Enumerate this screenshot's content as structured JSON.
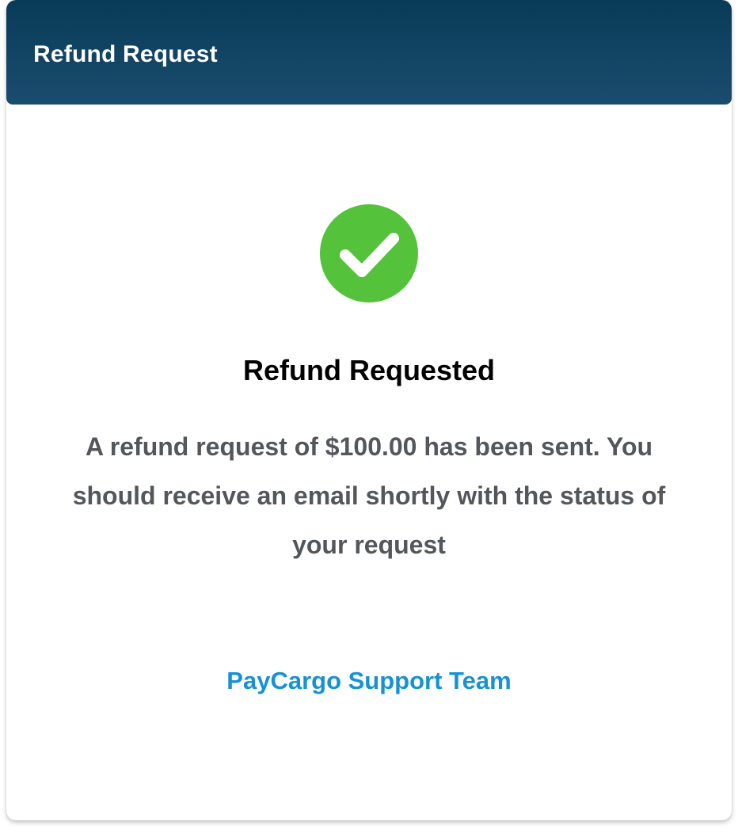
{
  "header": {
    "title": "Refund Request"
  },
  "status": {
    "icon": "check-circle-icon",
    "icon_color": "#54c23a",
    "title": "Refund Requested",
    "message": "A refund request of $100.00 has been sent. You should receive an email shortly with the status of your request"
  },
  "footer": {
    "signature": "PayCargo Support Team",
    "signature_color": "#1592d6"
  },
  "colors": {
    "header_top": "#083b58",
    "header_bottom": "#1b4c6e",
    "message_text": "#53565b"
  }
}
